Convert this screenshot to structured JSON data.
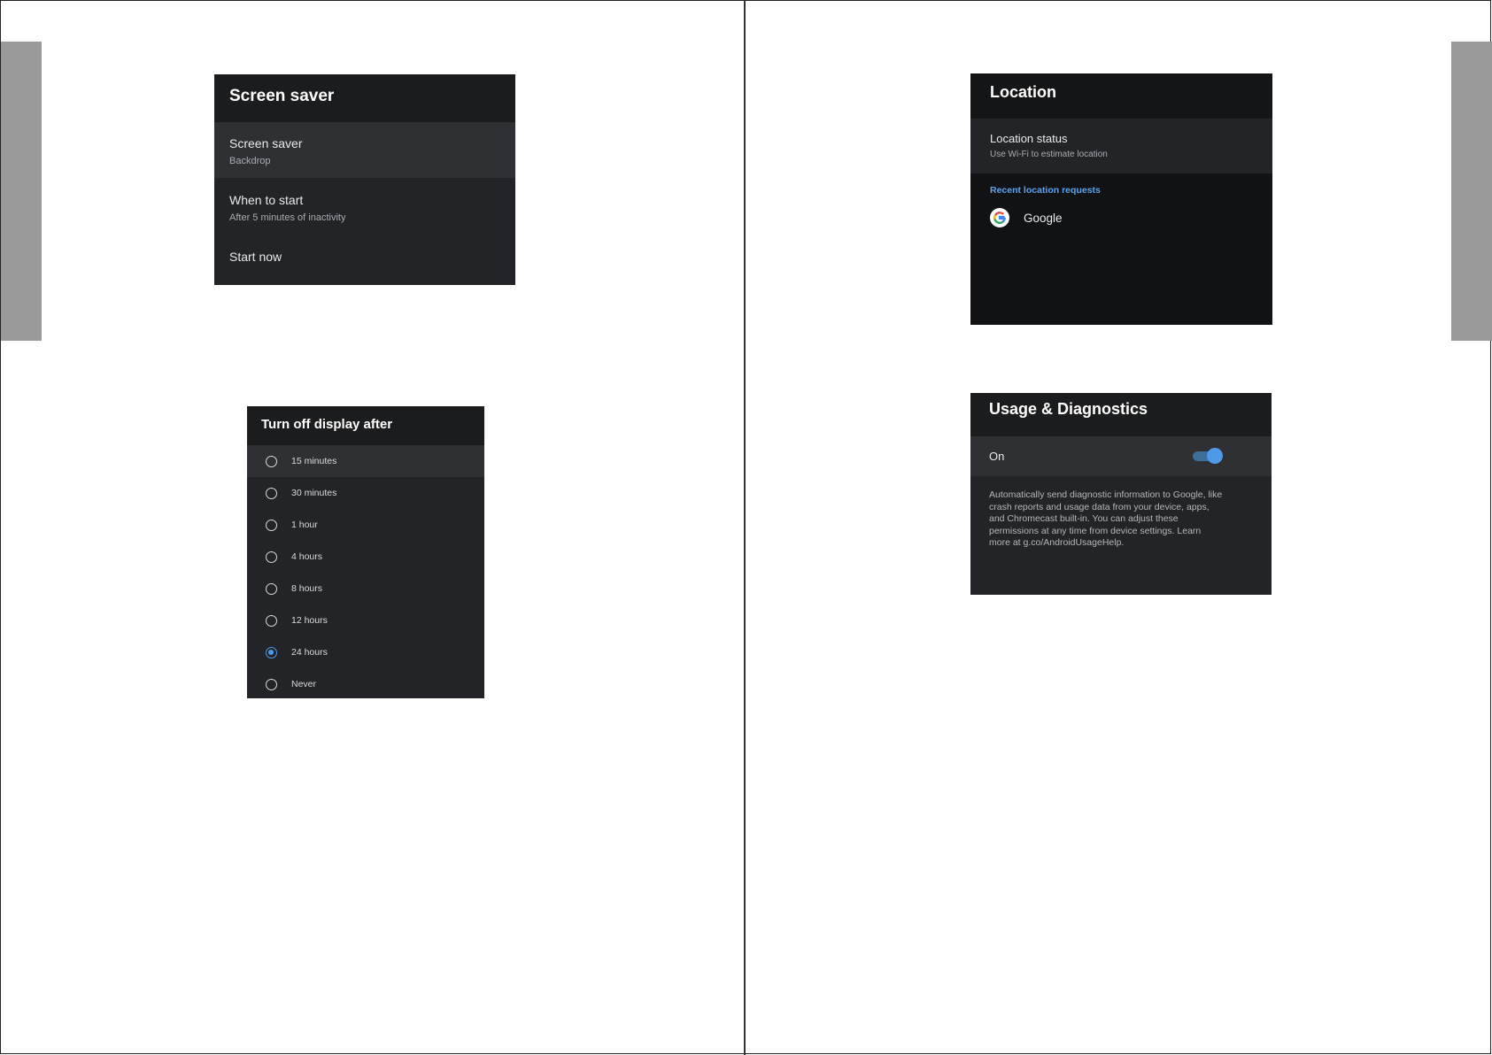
{
  "screen_saver": {
    "title": "Screen saver",
    "items": [
      {
        "title": "Screen saver",
        "subtitle": "Backdrop"
      },
      {
        "title": "When to start",
        "subtitle": "After 5 minutes of inactivity"
      },
      {
        "title": "Start now",
        "subtitle": ""
      }
    ]
  },
  "turn_off_display": {
    "title": "Turn off display after",
    "selected": "24 hours",
    "options": [
      "15 minutes",
      "30 minutes",
      "1 hour",
      "4 hours",
      "8 hours",
      "12 hours",
      "24 hours",
      "Never"
    ]
  },
  "location": {
    "title": "Location",
    "status_title": "Location status",
    "status_subtitle": "Use Wi-Fi to estimate location",
    "recent_label": "Recent location requests",
    "app_name": "Google",
    "app_icon": "google-icon"
  },
  "usage": {
    "title": "Usage & Diagnostics",
    "toggle_label": "On",
    "toggle_on": true,
    "description": "Automatically send diagnostic information to Google, like crash reports and usage data from your device, apps, and Chromecast built-in. You can adjust these permissions at any time from device settings. Learn more at g.co/AndroidUsageHelp."
  },
  "colors": {
    "panel_bg": "#222427",
    "header_bg": "#1b1c1e",
    "selected_row_bg": "#2e3034",
    "accent": "#4d9be8",
    "side_tab": "#9a9a9a"
  }
}
